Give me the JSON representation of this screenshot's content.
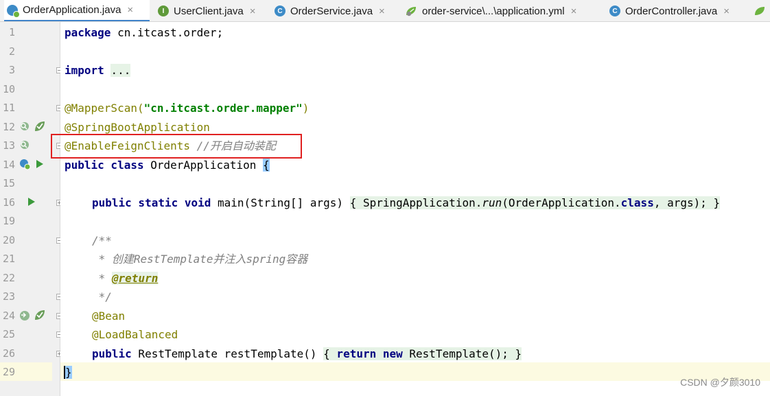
{
  "tabs": [
    {
      "label": "OrderApplication.java",
      "icon": "spring-boot-class-icon",
      "active": true
    },
    {
      "label": "UserClient.java",
      "icon": "interface-icon",
      "active": false
    },
    {
      "label": "OrderService.java",
      "icon": "class-icon",
      "active": false
    },
    {
      "label": "order-service\\...\\application.yml",
      "icon": "spring-yaml-icon",
      "active": false
    },
    {
      "label": "OrderController.java",
      "icon": "class-icon",
      "active": false
    }
  ],
  "tab_close_glyph": "×",
  "icon_letters": {
    "class": "C",
    "interface": "I"
  },
  "line_numbers": [
    "1",
    "2",
    "3",
    "10",
    "11",
    "12",
    "13",
    "14",
    "15",
    "16",
    "19",
    "20",
    "21",
    "22",
    "23",
    "24",
    "25",
    "26",
    "29"
  ],
  "code": {
    "l1_kw": "package",
    "l1_rest": " cn.itcast.order;",
    "l3_kw": "import",
    "l3_fold": "...",
    "l11_ann": "@MapperScan(",
    "l11_str": "\"cn.itcast.order.mapper\"",
    "l11_end": ")",
    "l12_ann": "@SpringBootApplication",
    "l13_ann": "@EnableFeignClients",
    "l13_cmt": " //开启自动装配",
    "l14_kw": "public class",
    "l14_name": " OrderApplication ",
    "l14_brace": "{",
    "l16_kw": "public static void",
    "l16_sig": " main(String[] args) ",
    "l16_open": "{",
    "l16_body": " SpringApplication.",
    "l16_run": "run",
    "l16_mid": "(OrderApplication.",
    "l16_class": "class",
    "l16_tail": ", args); ",
    "l16_close": "}",
    "l20_cmt": "/**",
    "l21_cmt": " * 创建RestTemplate并注入spring容器",
    "l22_star": " * ",
    "l22_tag": "@return",
    "l23_cmt": " */",
    "l24_ann": "@Bean",
    "l25_ann": "@LoadBalanced",
    "l26_kw": "public",
    "l26_sig": " RestTemplate restTemplate() ",
    "l26_open": "{",
    "l26_ret": " return new",
    "l26_tail": " RestTemplate(); ",
    "l26_close": "}",
    "l29_brace": "}"
  },
  "watermark": "CSDN @夕颜3010",
  "colors": {
    "keyword": "#000080",
    "annotation": "#808000",
    "string": "#008000",
    "comment": "#808080",
    "highlight_box": "#e02020"
  }
}
